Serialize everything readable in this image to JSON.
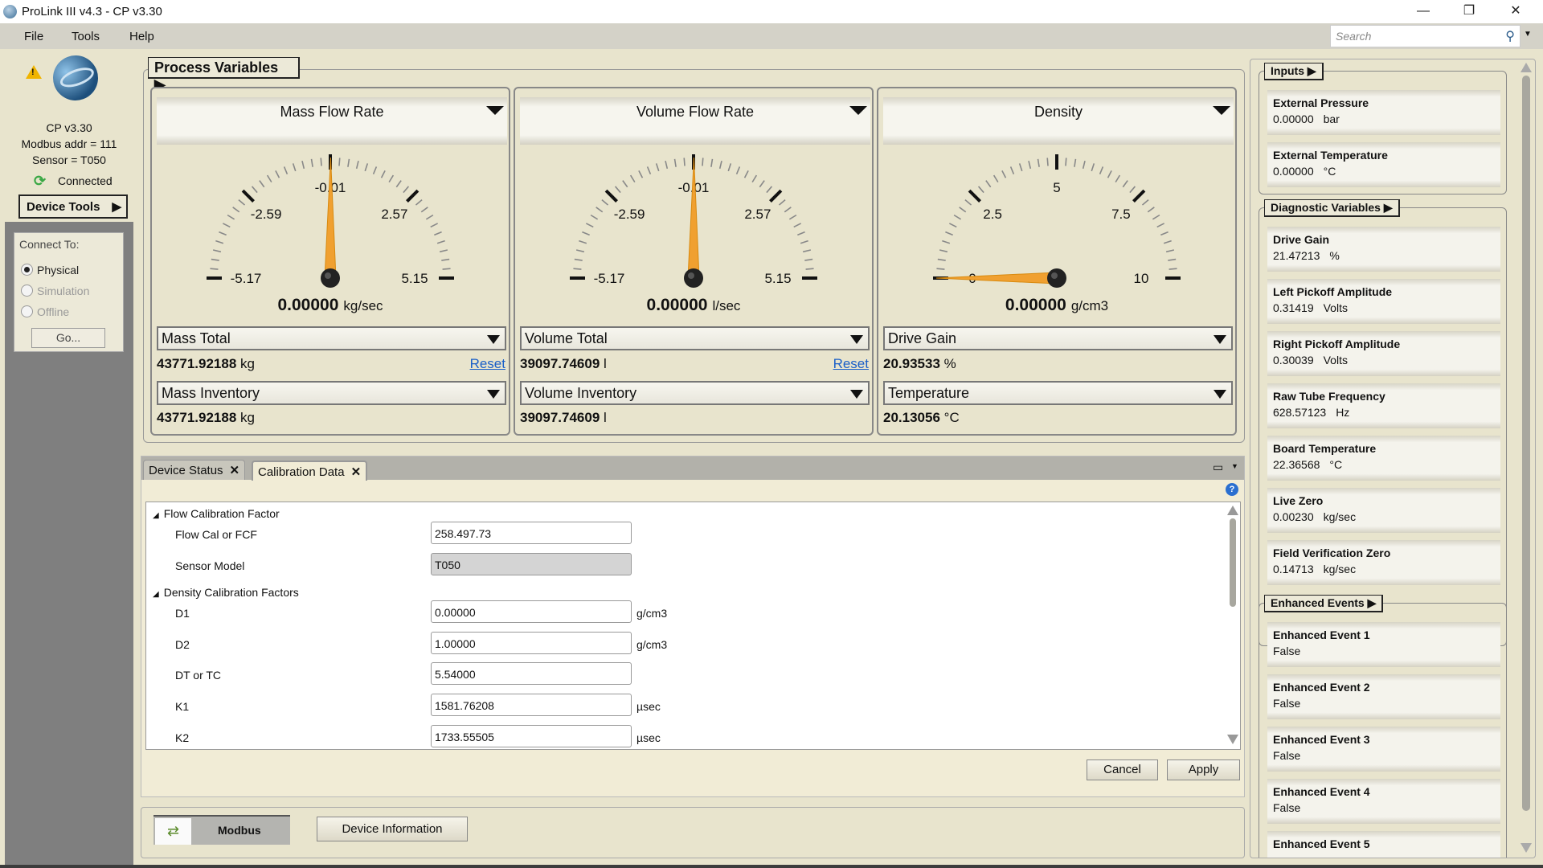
{
  "window": {
    "title": "ProLink III v4.3 - CP v3.30",
    "minimize": "—",
    "restore": "❐",
    "close": "✕"
  },
  "menu": {
    "items": [
      "File",
      "Tools",
      "Help"
    ],
    "search_placeholder": "Search"
  },
  "device": {
    "line1": "CP  v3.30",
    "line2": "Modbus addr = 111",
    "line3": "Sensor = T050",
    "status": "Connected",
    "status_color": "#3aa845",
    "tools_label": "Device Tools"
  },
  "connect": {
    "title": "Connect To:",
    "options": [
      {
        "label": "Physical",
        "selected": true
      },
      {
        "label": "Simulation",
        "selected": false
      },
      {
        "label": "Offline",
        "selected": false
      }
    ],
    "go_label": "Go..."
  },
  "process_variables": {
    "title": "Process Variables",
    "gauges": [
      {
        "title": "Mass Flow Rate",
        "min": -5.17,
        "max": 5.15,
        "value": 0.0,
        "labels": [
          "-5.17",
          "-2.59",
          "-0.01",
          "2.57",
          "5.15"
        ],
        "readout": "0.00000",
        "unit": "kg/sec",
        "total1_label": "Mass Total",
        "total1_value": "43771.92188",
        "total1_unit": "kg",
        "reset": "Reset",
        "total2_label": "Mass Inventory",
        "total2_value": "43771.92188",
        "total2_unit": "kg"
      },
      {
        "title": "Volume Flow Rate",
        "min": -5.17,
        "max": 5.15,
        "value": 0.0,
        "labels": [
          "-5.17",
          "-2.59",
          "-0.01",
          "2.57",
          "5.15"
        ],
        "readout": "0.00000",
        "unit": "l/sec",
        "total1_label": "Volume Total",
        "total1_value": "39097.74609",
        "total1_unit": "l",
        "reset": "Reset",
        "total2_label": "Volume Inventory",
        "total2_value": "39097.74609",
        "total2_unit": "l"
      },
      {
        "title": "Density",
        "min": 0,
        "max": 10,
        "value": 0.0,
        "labels": [
          "0",
          "2.5",
          "5",
          "7.5",
          "10"
        ],
        "readout": "0.00000",
        "unit": "g/cm3",
        "total1_label": "Drive Gain",
        "total1_value": "20.93533",
        "total1_unit": "%",
        "total2_label": "Temperature",
        "total2_value": "20.13056",
        "total2_unit": "°C"
      }
    ],
    "needle_color": "#f0a030"
  },
  "tabs": {
    "items": [
      {
        "label": "Device Status",
        "close": "✕"
      },
      {
        "label": "Calibration Data",
        "close": "✕"
      }
    ],
    "active": "Calibration Data"
  },
  "calibration": {
    "section1": "Flow Calibration Factor",
    "section2": "Density Calibration Factors",
    "fields": [
      {
        "label": "Flow Cal or FCF",
        "value": "258.497.73",
        "unit": ""
      },
      {
        "label": "Sensor Model",
        "value": "T050",
        "unit": "",
        "readonly": true
      },
      {
        "label": "D1",
        "value": "0.00000",
        "unit": "g/cm3"
      },
      {
        "label": "D2",
        "value": "1.00000",
        "unit": "g/cm3"
      },
      {
        "label": "DT or TC",
        "value": "5.54000",
        "unit": ""
      },
      {
        "label": "K1",
        "value": "1581.76208",
        "unit": "µsec"
      },
      {
        "label": "K2",
        "value": "1733.55505",
        "unit": "µsec"
      }
    ],
    "cancel": "Cancel",
    "apply": "Apply"
  },
  "bottom": {
    "protocol": "Modbus",
    "device_info": "Device Information"
  },
  "right": {
    "inputs": {
      "title": "Inputs",
      "items": [
        {
          "name": "External Pressure",
          "value": "0.00000",
          "unit": "bar"
        },
        {
          "name": "External Temperature",
          "value": "0.00000",
          "unit": "°C"
        }
      ]
    },
    "diagnostics": {
      "title": "Diagnostic Variables",
      "items": [
        {
          "name": "Drive Gain",
          "value": "21.47213",
          "unit": "%"
        },
        {
          "name": "Left Pickoff Amplitude",
          "value": "0.31419",
          "unit": "Volts"
        },
        {
          "name": "Right Pickoff Amplitude",
          "value": "0.30039",
          "unit": "Volts"
        },
        {
          "name": "Raw Tube Frequency",
          "value": "628.57123",
          "unit": "Hz"
        },
        {
          "name": "Board Temperature",
          "value": "22.36568",
          "unit": "°C"
        },
        {
          "name": "Live Zero",
          "value": "0.00230",
          "unit": "kg/sec"
        },
        {
          "name": "Field Verification Zero",
          "value": "0.14713",
          "unit": "kg/sec"
        }
      ]
    },
    "events": {
      "title": "Enhanced Events",
      "items": [
        {
          "name": "Enhanced Event 1",
          "value": "False"
        },
        {
          "name": "Enhanced Event 2",
          "value": "False"
        },
        {
          "name": "Enhanced Event 3",
          "value": "False"
        },
        {
          "name": "Enhanced Event 4",
          "value": "False"
        },
        {
          "name": "Enhanced Event 5",
          "value": ""
        }
      ]
    }
  }
}
